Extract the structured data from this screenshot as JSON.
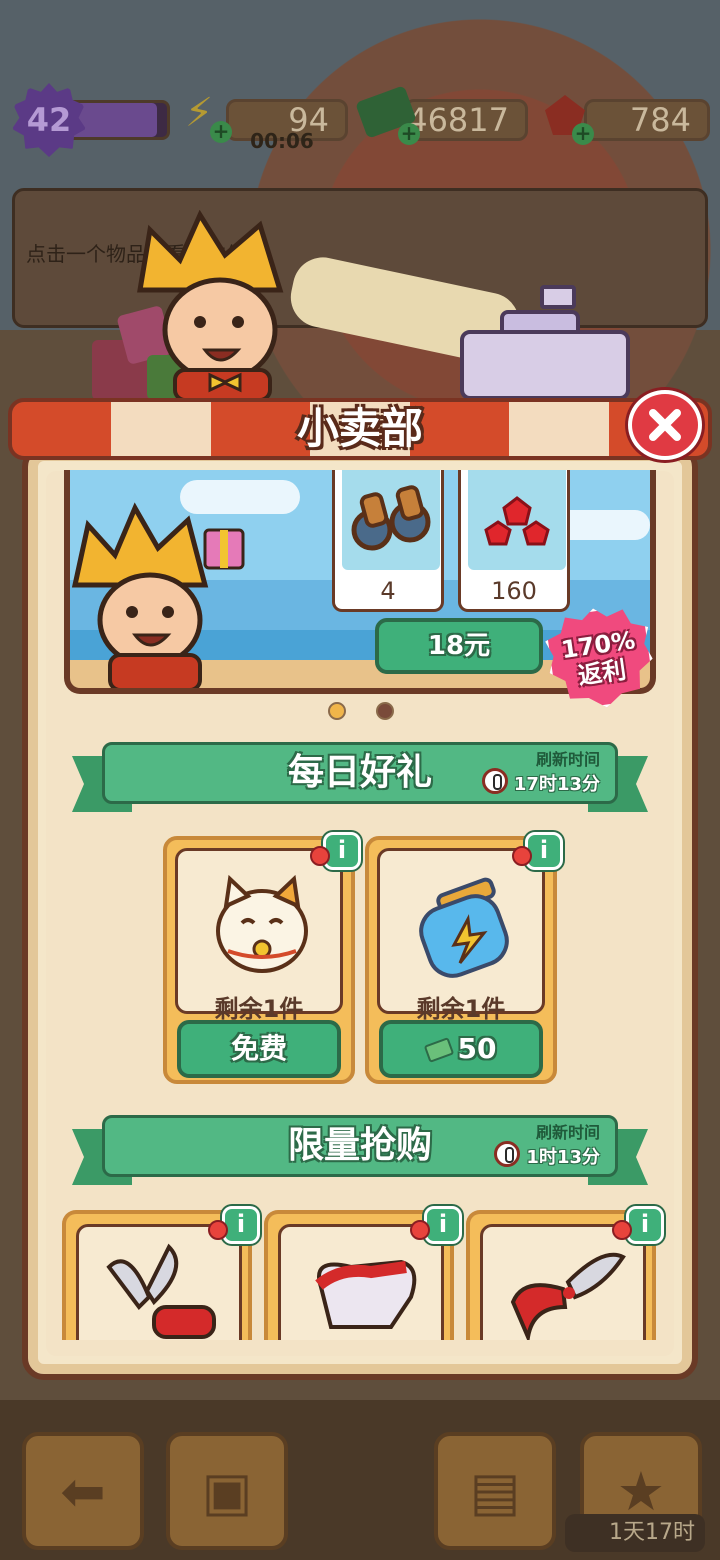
{
  "hud": {
    "level": "42",
    "level_progress": 0.9,
    "energy": "94",
    "energy_timer": "00:06",
    "cash": "46817",
    "gems": "784"
  },
  "info_panel": {
    "hint": "点击一个物品查看它的信息"
  },
  "shop": {
    "title": "小卖部",
    "banner": {
      "items": [
        {
          "icon": "binoculars-icon",
          "qty": "4"
        },
        {
          "icon": "ruby-gems-icon",
          "qty": "160"
        }
      ],
      "price": "18元",
      "rebate_line1": "170%",
      "rebate_line2": "返利",
      "page_index": 0,
      "page_count": 2
    },
    "daily": {
      "title": "每日好礼",
      "refresh_label": "刷新时间",
      "refresh_time": "17时13分",
      "items": [
        {
          "icon": "lucky-cat-icon",
          "remaining": "剩余1件",
          "button": "免费"
        },
        {
          "icon": "energy-jar-icon",
          "remaining": "剩余1件",
          "button": "50",
          "currency": "cash-icon"
        }
      ]
    },
    "limited": {
      "title": "限量抢购",
      "refresh_label": "刷新时间",
      "refresh_time": "1时13分",
      "items": [
        {
          "icon": "pruning-shears-icon"
        },
        {
          "icon": "glove-icon"
        },
        {
          "icon": "pruning-shears-icon"
        }
      ]
    }
  },
  "nav": {
    "timer": "1天17时"
  },
  "colors": {
    "accent_green": "#3fb07a",
    "awning_red": "#d44b2a",
    "close_red": "#e03a43",
    "rebate_pink": "#f04a7e"
  }
}
